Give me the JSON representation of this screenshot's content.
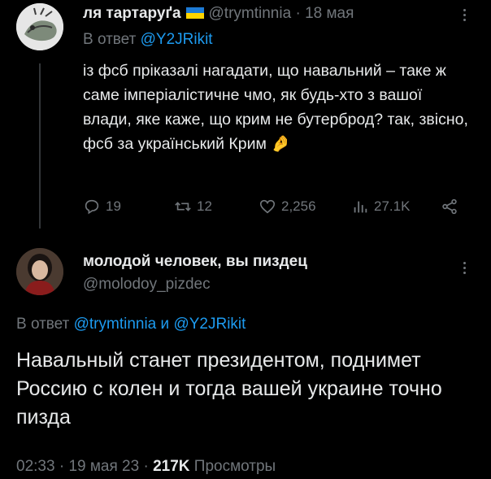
{
  "tweet1": {
    "display_name": "ля тартаруґа",
    "handle": "@trymtinnia",
    "separator": "·",
    "date": "18 мая",
    "reply_prefix": "В ответ",
    "reply_to": "@Y2JRikit",
    "text": "із фсб пріказалі нагадати, що навальний – таке ж саме імперіалістичне чмо, як будь-хто з вашої влади, яке каже, що крим не бутерброд? так, звісно, фсб за український Крим",
    "emoji": "🤌",
    "actions": {
      "replies": "19",
      "retweets": "12",
      "likes": "2,256",
      "views": "27.1K"
    }
  },
  "tweet2": {
    "display_name": "молодой человек, вы пиздец",
    "handle": "@molodoy_pizdec",
    "reply_prefix": "В ответ",
    "reply_to_1": "@trymtinnia",
    "reply_and": "и",
    "reply_to_2": "@Y2JRikit",
    "text": "Навальный станет президентом, поднимет Россию с колен и тогда вашей украине точно пизда",
    "time": "02:33",
    "date": "19 мая 23",
    "views_count": "217K",
    "views_label": "Просмотры"
  },
  "icons": [
    "avatar",
    "ukraine-flag",
    "more-icon",
    "reply-icon",
    "retweet-icon",
    "like-icon",
    "views-icon",
    "share-icon",
    "pinched-fingers-emoji"
  ],
  "colors": {
    "background": "#000000",
    "text": "#e7e9ea",
    "muted": "#71767b",
    "link": "#1d9bf0"
  }
}
